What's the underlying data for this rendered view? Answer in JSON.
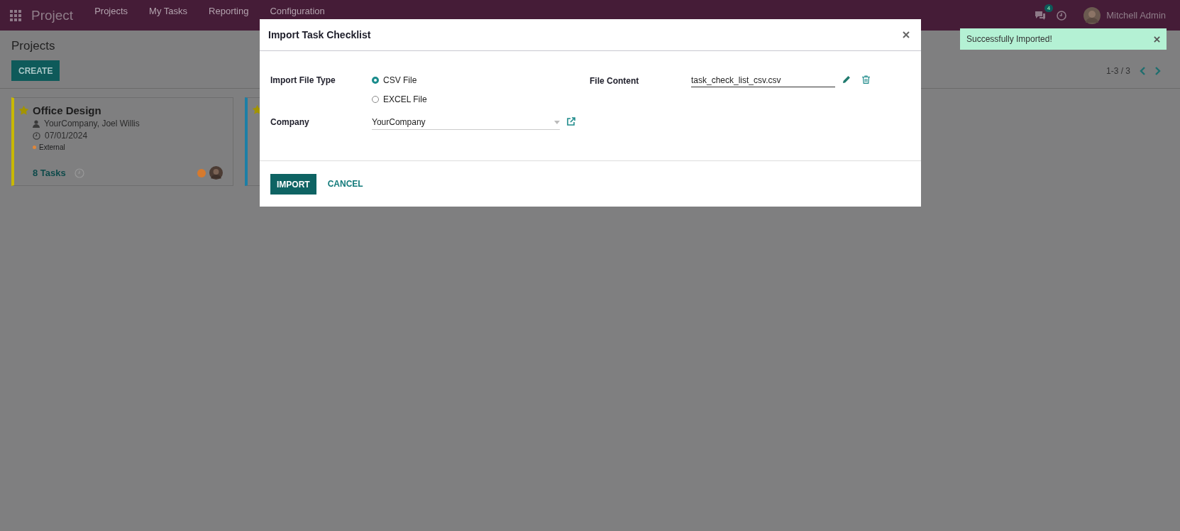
{
  "navbar": {
    "app_name": "Project",
    "menu": [
      {
        "label": "Projects"
      },
      {
        "label": "My Tasks"
      },
      {
        "label": "Reporting"
      },
      {
        "label": "Configuration"
      }
    ],
    "messages_count": "4",
    "user": "Mitchell Admin"
  },
  "control_panel": {
    "breadcrumb": "Projects",
    "create_button": "CREATE",
    "pager": "1-3 / 3"
  },
  "cards": [
    {
      "title": "Office Design",
      "favorite": true,
      "color": "#c9b800",
      "customer": "YourCompany, Joel Willis",
      "date": "07/01/2024",
      "tag": {
        "label": "External",
        "color": "#e0873a"
      },
      "tasks": "8 Tasks",
      "status": {
        "color": "#d67a2e"
      }
    },
    {
      "favorite": true,
      "color": "#1c7fa6"
    }
  ],
  "dialog": {
    "title": "Import Task Checklist",
    "file_type_label": "Import File Type",
    "file_types": [
      {
        "label": "CSV File",
        "selected": true
      },
      {
        "label": "EXCEL File",
        "selected": false
      }
    ],
    "company_label": "Company",
    "company": "YourCompany",
    "file_content_label": "File Content",
    "file_name": "task_check_list_csv.csv",
    "buttons": [
      {
        "label": "IMPORT",
        "kind": "primary"
      },
      {
        "label": "CANCEL",
        "kind": "link"
      }
    ]
  },
  "toast": {
    "message": "Successfully Imported!"
  }
}
